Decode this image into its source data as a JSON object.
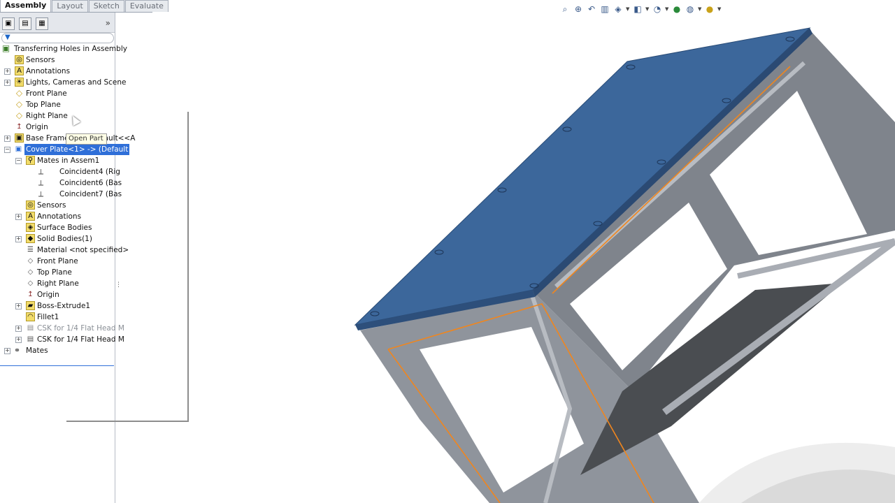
{
  "command_tabs": [
    "Assembly",
    "Layout",
    "Sketch",
    "Evaluate"
  ],
  "active_tab": "Assembly",
  "tree": {
    "root": "Transferring Holes in Assembly",
    "items": [
      {
        "label": "Sensors"
      },
      {
        "label": "Annotations"
      },
      {
        "label": "Lights, Cameras and Scene"
      },
      {
        "label": "Front Plane"
      },
      {
        "label": "Top Plane"
      },
      {
        "label": "Right Plane"
      },
      {
        "label": "Origin"
      },
      {
        "label": "Base Frame<1> (Default<<A"
      },
      {
        "label": "Cover Plate<1> -> (Default"
      },
      {
        "label": "Mates in Assem1"
      },
      {
        "label": "Coincident4 (Rig"
      },
      {
        "label": "Coincident6 (Bas"
      },
      {
        "label": "Coincident7 (Bas"
      },
      {
        "label": "Sensors"
      },
      {
        "label": "Annotations"
      },
      {
        "label": "Surface Bodies"
      },
      {
        "label": "Solid Bodies(1)"
      },
      {
        "label": "Material <not specified>"
      },
      {
        "label": "Front Plane"
      },
      {
        "label": "Top Plane"
      },
      {
        "label": "Right Plane"
      },
      {
        "label": "Origin"
      },
      {
        "label": "Boss-Extrude1"
      },
      {
        "label": "Fillet1"
      },
      {
        "label": "CSK for 1/4 Flat Head M"
      },
      {
        "label": "CSK for 1/4 Flat Head M"
      },
      {
        "label": "Mates"
      }
    ]
  },
  "tooltip": "Open Part",
  "colors": {
    "plate": "#3c679b",
    "frame": "#8d929a",
    "highlight": "#f0861e",
    "selection": "#2f6fd8"
  }
}
